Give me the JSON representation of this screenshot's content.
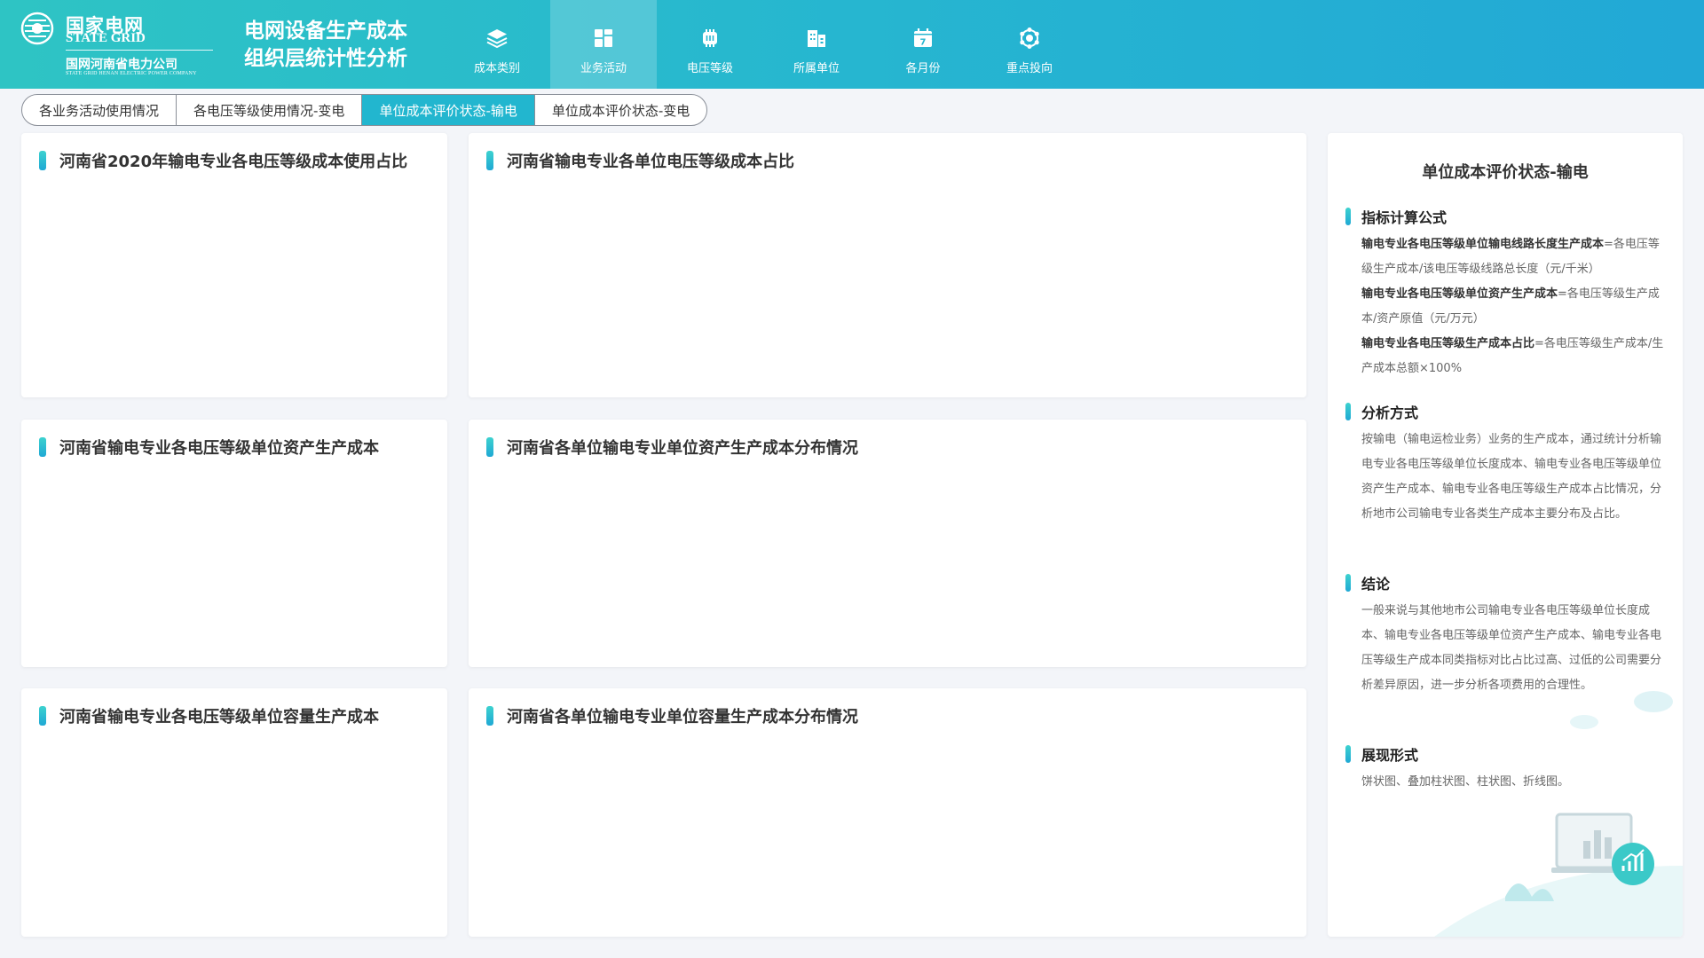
{
  "brand": {
    "name_cn": "国家电网",
    "name_en": "STATE GRID",
    "sub_cn": "国网河南省电力公司",
    "sub_en": "STATE GRID HENAN ELECTRIC POWER COMPANY"
  },
  "header": {
    "title_line1": "电网设备生产成本",
    "title_line2": "组织层统计性分析"
  },
  "nav": {
    "items": [
      {
        "label": "成本类别",
        "icon": "layers-icon"
      },
      {
        "label": "业务活动",
        "icon": "dashboard-icon",
        "active": true
      },
      {
        "label": "电压等级",
        "icon": "chip-icon"
      },
      {
        "label": "所属单位",
        "icon": "building-icon"
      },
      {
        "label": "各月份",
        "icon": "calendar-icon",
        "day": "7"
      },
      {
        "label": "重点投向",
        "icon": "hub-icon"
      }
    ]
  },
  "subtabs": [
    {
      "label": "各业务活动使用情况"
    },
    {
      "label": "各电压等级使用情况-变电"
    },
    {
      "label": "单位成本评价状态-输电",
      "active": true
    },
    {
      "label": "单位成本评价状态-变电"
    }
  ],
  "cards": [
    {
      "title": "河南省2020年输电专业各电压等级成本使用占比"
    },
    {
      "title": "河南省输电专业各单位电压等级成本占比"
    },
    {
      "title": "河南省输电专业各电压等级单位资产生产成本"
    },
    {
      "title": "河南省各单位输电专业单位资产生产成本分布情况"
    },
    {
      "title": "河南省输电专业各电压等级单位容量生产成本"
    },
    {
      "title": "河南省各单位输电专业单位容量生产成本分布情况"
    }
  ],
  "side": {
    "title": "单位成本评价状态-输电",
    "formula": {
      "heading": "指标计算公式",
      "items": [
        {
          "term": "输电专业各电压等级单位输电线路长度生产成本",
          "rest": "=各电压等级生产成本/该电压等级线路总长度（元/千米）"
        },
        {
          "term": "输电专业各电压等级单位资产生产成本",
          "rest": "=各电压等级生产成本/资产原值（元/万元）"
        },
        {
          "term": "输电专业各电压等级生产成本占比",
          "rest": "=各电压等级生产成本/生产成本总额×100%"
        }
      ]
    },
    "method": {
      "heading": "分析方式",
      "text": "按输电（输电运检业务）业务的生产成本，通过统计分析输电专业各电压等级单位长度成本、输电专业各电压等级单位资产生产成本、输电专业各电压等级生产成本占比情况，分析地市公司输电专业各类生产成本主要分布及占比。"
    },
    "conclusion": {
      "heading": "结论",
      "text": "一般来说与其他地市公司输电专业各电压等级单位长度成本、输电专业各电压等级单位资产生产成本、输电专业各电压等级生产成本同类指标对比占比过高、过低的公司需要分析差异原因，进一步分析各项费用的合理性。"
    },
    "display": {
      "heading": "展现形式",
      "text": "饼状图、叠加柱状图、柱状图、折线图。"
    }
  },
  "colors": {
    "accent": "#22b6cf",
    "header_start": "#2ec4c4",
    "header_end": "#22a8d6"
  }
}
